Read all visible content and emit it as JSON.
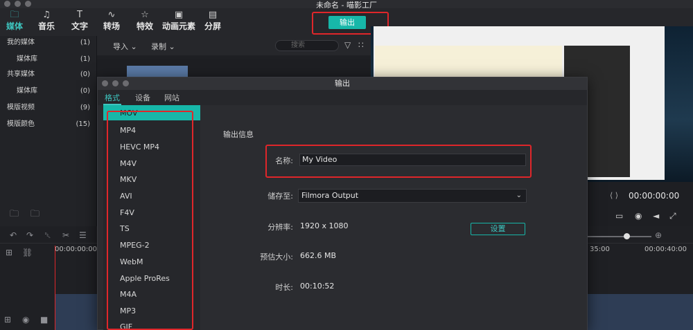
{
  "window": {
    "title": "未命名 - 喵影工厂"
  },
  "toolbar": {
    "tabs": [
      {
        "label": "媒体",
        "icon": "folder-icon"
      },
      {
        "label": "音乐",
        "icon": "music-note-icon"
      },
      {
        "label": "文字",
        "icon": "text-icon"
      },
      {
        "label": "转场",
        "icon": "transition-icon"
      },
      {
        "label": "特效",
        "icon": "effects-icon"
      },
      {
        "label": "动画元素",
        "icon": "image-icon"
      },
      {
        "label": "分屏",
        "icon": "splitscreen-icon"
      }
    ],
    "export_label": "输出"
  },
  "library": {
    "items": [
      {
        "label": "我的媒体",
        "count": "(1)"
      },
      {
        "label": "媒体库",
        "count": "(1)"
      },
      {
        "label": "共享媒体",
        "count": "(0)"
      },
      {
        "label": "媒体库",
        "count": "(0)"
      },
      {
        "label": "模版视频",
        "count": "(9)"
      },
      {
        "label": "模版颜色",
        "count": "(15)"
      }
    ]
  },
  "media": {
    "import_label": "导入",
    "record_label": "录制",
    "search_placeholder": "搜索"
  },
  "preview": {
    "timecode": "00:00:00:00"
  },
  "timeline": {
    "ruler_labels": [
      "00:00:00:00",
      "35:00",
      "00:00:40:00"
    ]
  },
  "dialog": {
    "title": "输出",
    "tabs": [
      "格式",
      "设备",
      "网站"
    ],
    "formats": [
      "MOV",
      "MP4",
      "HEVC MP4",
      "M4V",
      "MKV",
      "AVI",
      "F4V",
      "TS",
      "MPEG-2",
      "WebM",
      "Apple ProRes",
      "M4A",
      "MP3",
      "GIF"
    ],
    "section_title": "输出信息",
    "name_label": "名称:",
    "name_value": "My Video",
    "save_label": "储存至:",
    "save_value": "Filmora Output",
    "resolution_label": "分辨率:",
    "resolution_value": "1920 x 1080",
    "settings_label": "设置",
    "size_label": "预估大小:",
    "size_value": "662.6 MB",
    "duration_label": "时长:",
    "duration_value": "00:10:52"
  },
  "colors": {
    "accent": "#17b7a9",
    "highlight": "#e0262a",
    "background": "#1e1f23"
  }
}
